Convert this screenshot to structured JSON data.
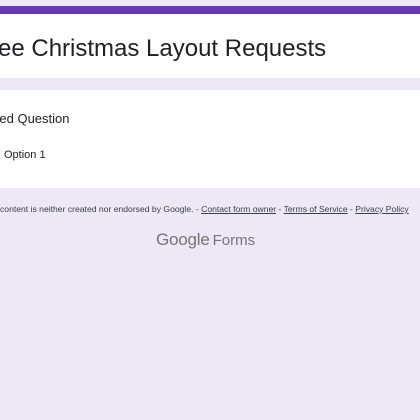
{
  "colors": {
    "accent": "#673ab7",
    "background": "#ede7f6",
    "card": "#ffffff"
  },
  "form": {
    "title": "ree Christmas Layout Requests"
  },
  "question": {
    "title": "itled Question",
    "options": [
      {
        "label": "Option 1",
        "icon": "radio-button-icon"
      }
    ]
  },
  "footer": {
    "disclaimer": "content is neither created nor endorsed by Google.",
    "sep1": " - ",
    "contact_link": "Contact form owner",
    "sep2": " - ",
    "terms_link": "Terms of Service",
    "sep3": " - ",
    "privacy_link": "Privacy Policy"
  },
  "logo": {
    "google": "Google",
    "forms": "Forms"
  }
}
